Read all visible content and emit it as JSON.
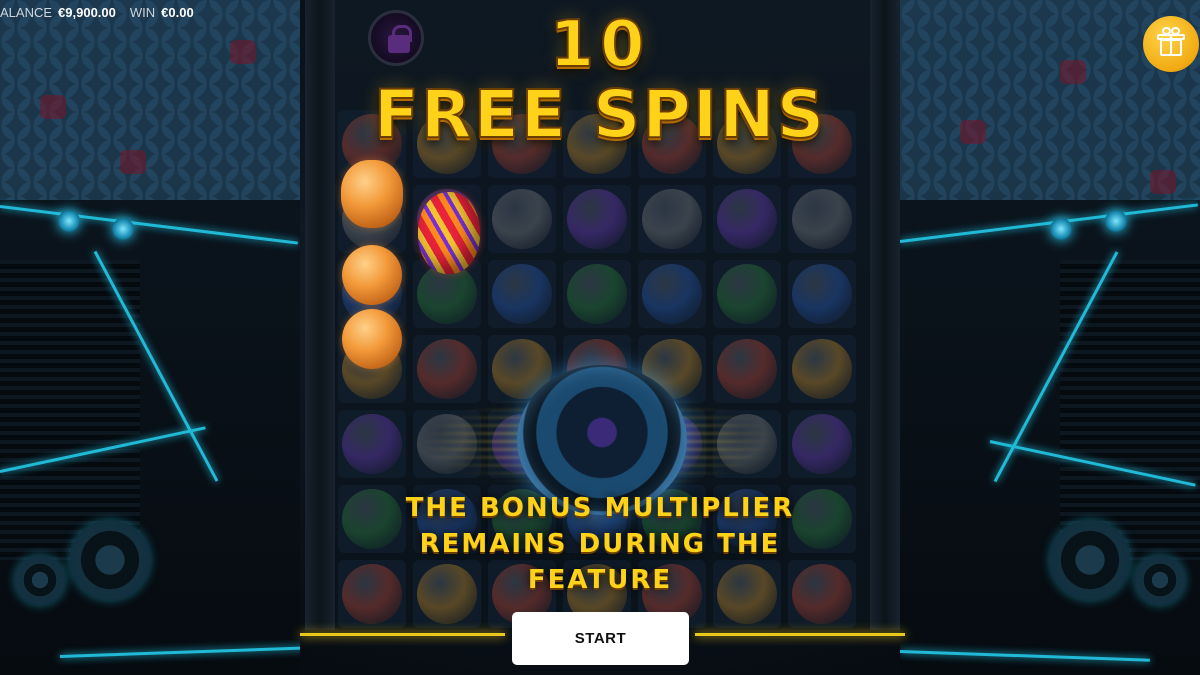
{
  "hud": {
    "balance_label": "ALANCE",
    "balance_value": "€9,900.00",
    "win_label": "WIN",
    "win_value": "€0.00"
  },
  "banner": {
    "spins_count": "10",
    "spins_label": "FREE SPINS"
  },
  "feature_message": {
    "line1": "THE BONUS MULTIPLIER",
    "line2": "REMAINS DURING THE",
    "line3": "FEATURE"
  },
  "start_button": {
    "label": "START"
  },
  "icons": {
    "gift": "gift-icon",
    "lock": "lock-icon"
  },
  "colors": {
    "title_yellow": "#ffd21a",
    "neon_cyan": "#21b9d6",
    "gift_gold": "#f1aa12",
    "background_dark": "#0a1119"
  }
}
